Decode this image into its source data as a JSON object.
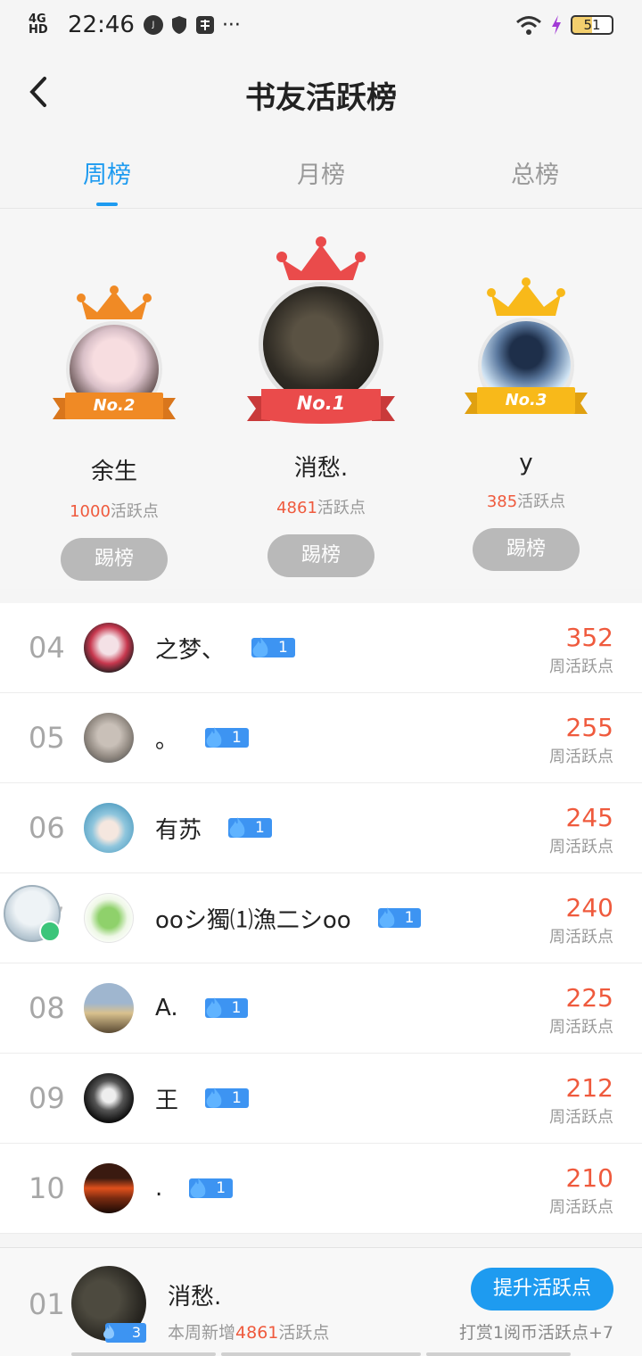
{
  "status_bar": {
    "network": "4G HD",
    "time": "22:46",
    "battery": "51"
  },
  "header": {
    "title": "书友活跃榜"
  },
  "tabs": [
    {
      "label": "周榜",
      "active": true
    },
    {
      "label": "月榜",
      "active": false
    },
    {
      "label": "总榜",
      "active": false
    }
  ],
  "podium": [
    {
      "badge": "No.2",
      "name": "余生",
      "points": "1000",
      "points_suffix": "活跃点",
      "button": "踢榜"
    },
    {
      "badge": "No.1",
      "name": "消愁.",
      "points": "4861",
      "points_suffix": "活跃点",
      "button": "踢榜"
    },
    {
      "badge": "No.3",
      "name": "y",
      "points": "385",
      "points_suffix": "活跃点",
      "button": "踢榜"
    }
  ],
  "list": [
    {
      "rank": "04",
      "name": "之梦、",
      "level": "1",
      "points": "352",
      "unit": "周活跃点"
    },
    {
      "rank": "05",
      "name": "。",
      "level": "1",
      "points": "255",
      "unit": "周活跃点"
    },
    {
      "rank": "06",
      "name": "有苏",
      "level": "1",
      "points": "245",
      "unit": "周活跃点"
    },
    {
      "rank": "07",
      "name": "ooシ獨⑴漁二シoo",
      "level": "1",
      "points": "240",
      "unit": "周活跃点"
    },
    {
      "rank": "08",
      "name": "A.",
      "level": "1",
      "points": "225",
      "unit": "周活跃点"
    },
    {
      "rank": "09",
      "name": "王",
      "level": "1",
      "points": "212",
      "unit": "周活跃点"
    },
    {
      "rank": "10",
      "name": ".",
      "level": "1",
      "points": "210",
      "unit": "周活跃点"
    }
  ],
  "me": {
    "rank": "01",
    "name": "消愁.",
    "level": "3",
    "week_prefix": "本周新增",
    "week_points": "4861",
    "week_suffix": "活跃点",
    "boost_button": "提升活跃点",
    "reward_note": "打赏1阅币活跃点+7"
  },
  "colors": {
    "accent": "#1e9bf0",
    "points": "#ef5a3d",
    "gold": "#f8b91a",
    "silver_orange": "#f08a25",
    "first_red": "#ea4b4b"
  }
}
